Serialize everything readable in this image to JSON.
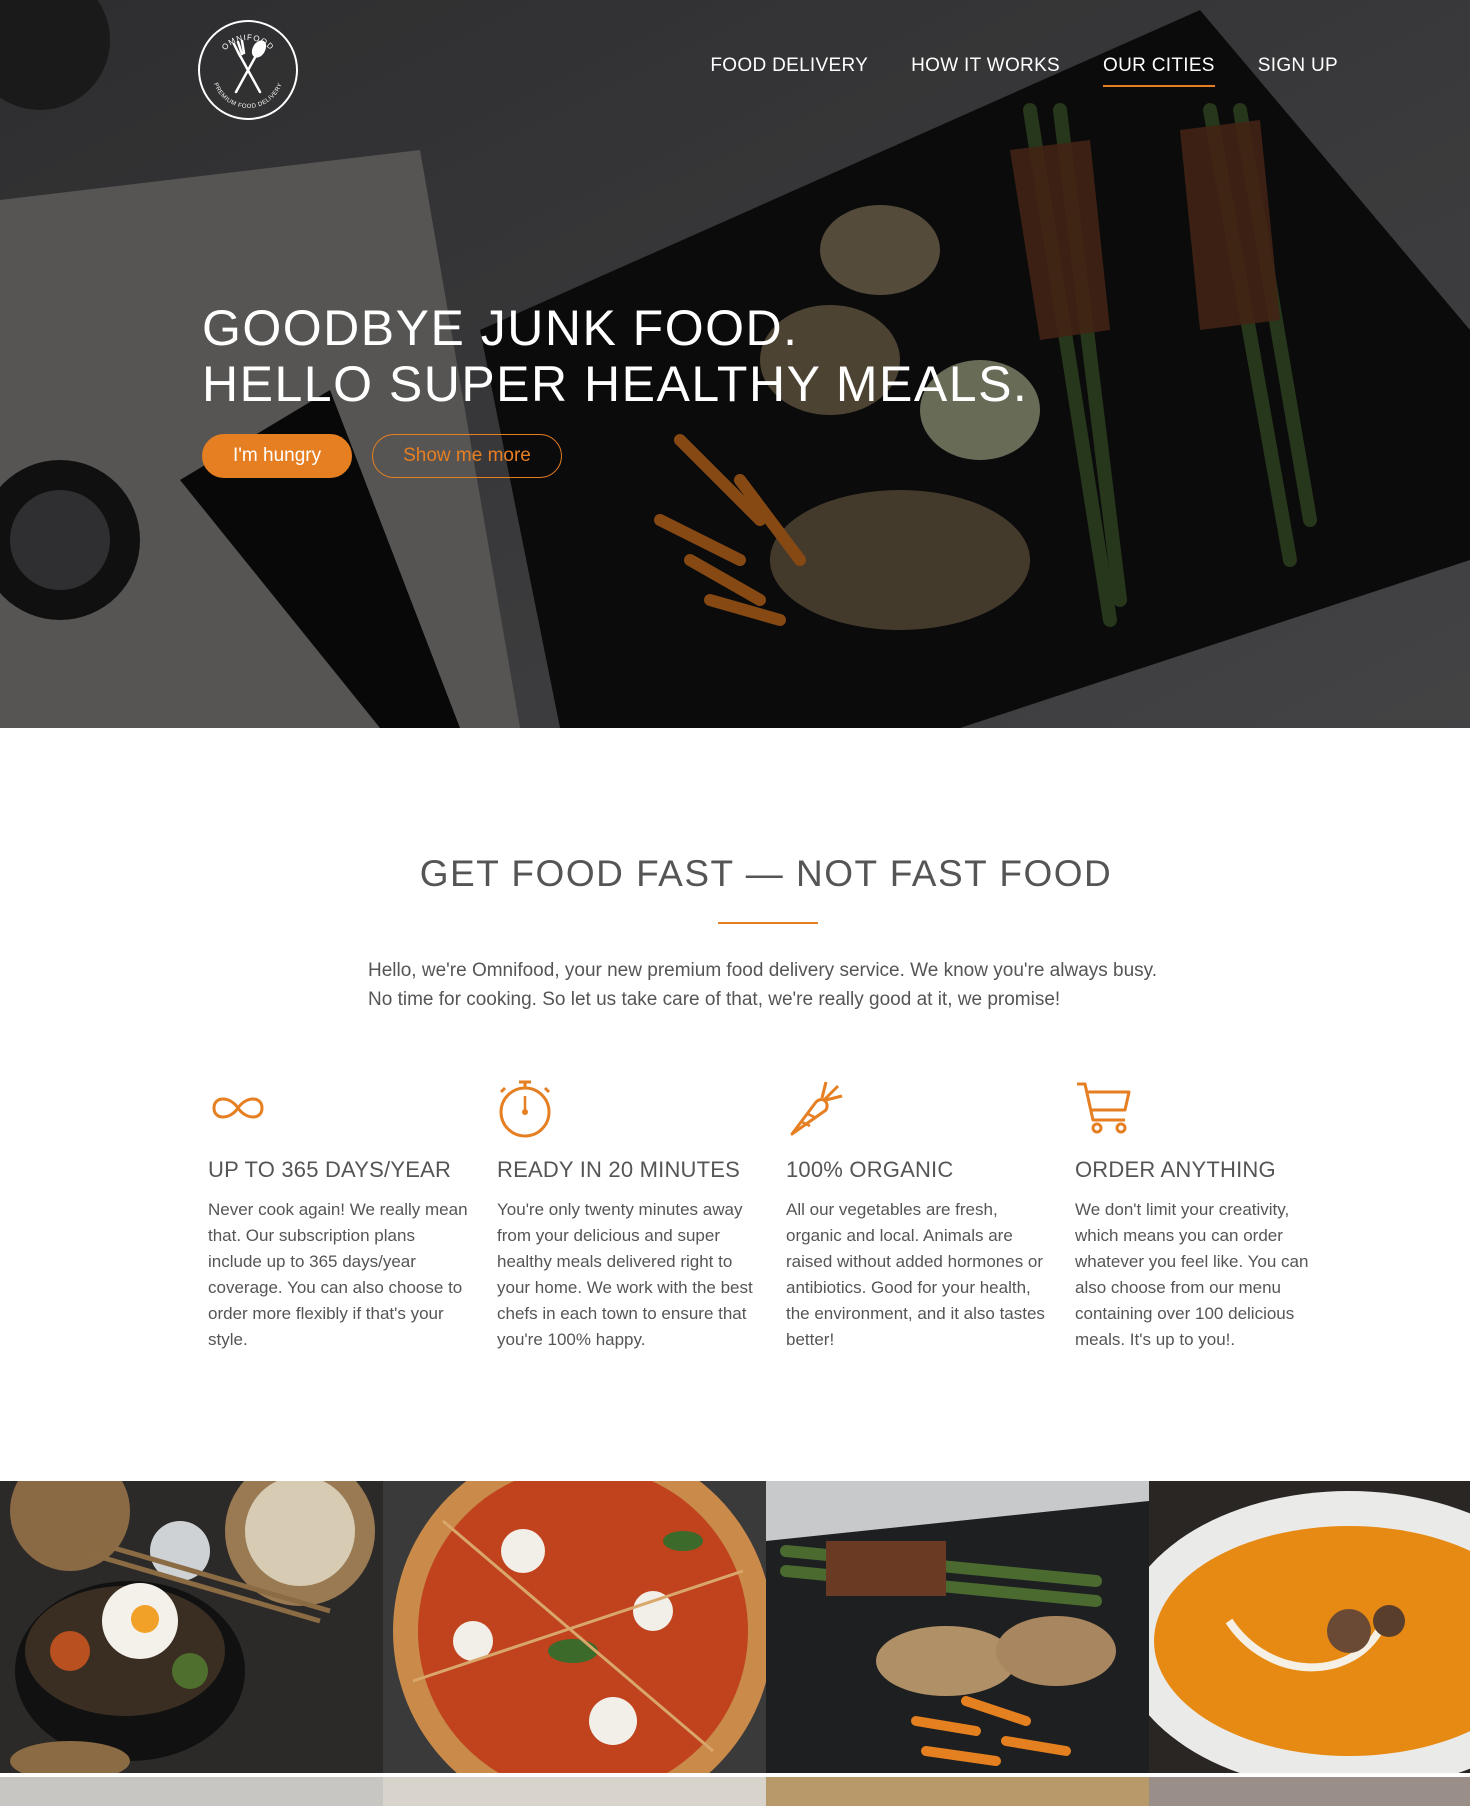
{
  "nav": {
    "items": [
      {
        "label": "FOOD DELIVERY",
        "active": false
      },
      {
        "label": "HOW IT WORKS",
        "active": false
      },
      {
        "label": "OUR CITIES",
        "active": true
      },
      {
        "label": "SIGN UP",
        "active": false
      }
    ]
  },
  "logo": {
    "top_text": "OMNIFOOD",
    "bottom_text": "PREMIUM FOOD DELIVERY"
  },
  "hero": {
    "title_line1": "GOODBYE JUNK FOOD.",
    "title_line2": "HELLO SUPER HEALTHY MEALS.",
    "primary_button": "I'm hungry",
    "secondary_button": "Show me more"
  },
  "features": {
    "title": "GET FOOD FAST — NOT FAST FOOD",
    "intro_line1": "Hello, we're Omnifood, your new premium food delivery service. We know you're always busy.",
    "intro_line2": "No time for cooking. So let us take care of that, we're really good at it, we promise!",
    "items": [
      {
        "icon": "infinity-icon",
        "title": "UP TO 365 DAYS/YEAR",
        "text": "Never cook again! We really mean that. Our subscription plans include up to 365 days/year coverage. You can also choose to order more flexibly if that's your style."
      },
      {
        "icon": "stopwatch-icon",
        "title": "READY IN 20 MINUTES",
        "text": "You're only twenty minutes away from your delicious and super healthy meals delivered right to your home. We work with the best chefs in each town to ensure that you're 100% happy."
      },
      {
        "icon": "carrot-icon",
        "title": "100% ORGANIC",
        "text": "All our vegetables are fresh, organic and local. Animals are raised without added hormones or antibiotics. Good for your health, the environment, and it also tastes better!"
      },
      {
        "icon": "cart-icon",
        "title": "ORDER ANYTHING",
        "text": "We don't limit your creativity, which means you can order whatever you feel like. You can also choose from our menu containing over 100 delicious meals. It's up to you!."
      }
    ]
  },
  "colors": {
    "accent": "#e67e22",
    "text": "#555555",
    "hero_overlay": "#2b2b2e"
  }
}
